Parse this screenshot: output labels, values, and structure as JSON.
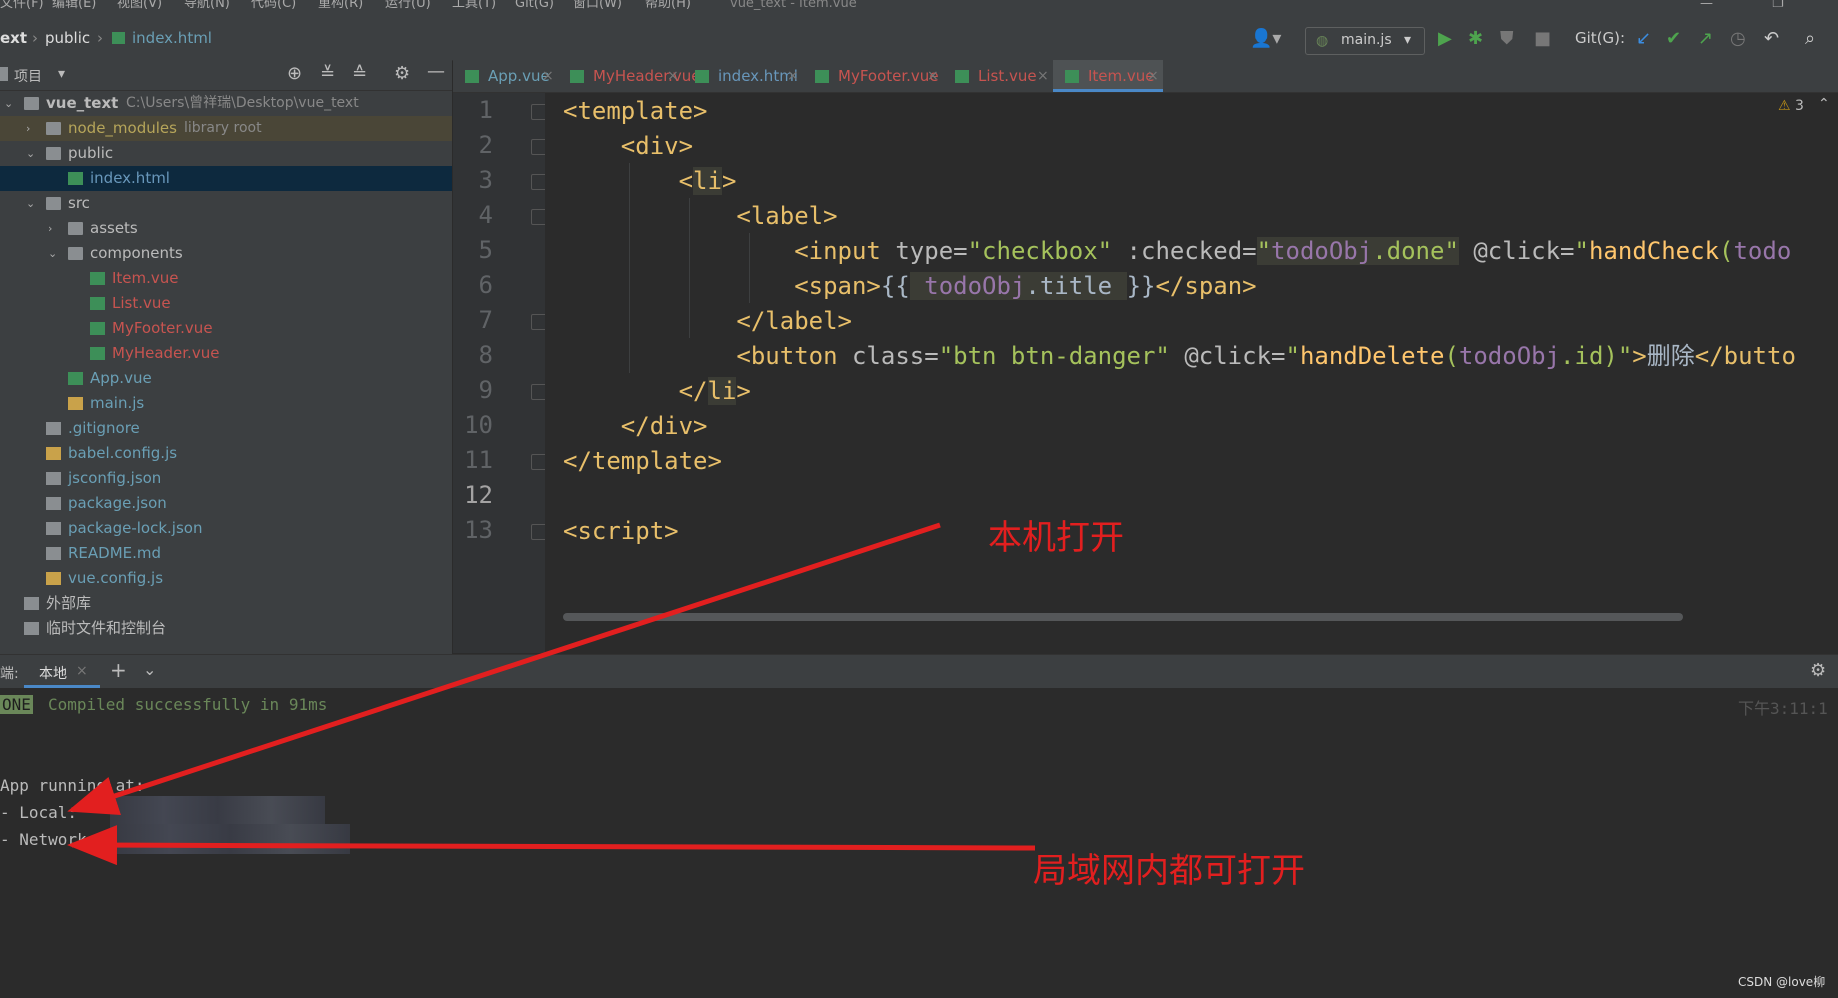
{
  "menu": {
    "items": [
      "文件(F)",
      "编辑(E)",
      "视图(V)",
      "导航(N)",
      "代码(C)",
      "重构(R)",
      "运行(U)",
      "工具(T)",
      "Git(G)",
      "窗口(W)",
      "帮助(H)"
    ],
    "window_title": "vue_text - Item.vue"
  },
  "breadcrumb": [
    "ext",
    "public",
    "index.html"
  ],
  "toolbar": {
    "run_config": "main.js",
    "git_label": "Git(G):"
  },
  "project_panel": {
    "title": "项目"
  },
  "tree": [
    {
      "label": "vue_text",
      "extra": "C:\\Users\\曾祥瑞\\Desktop\\vue_text",
      "type": "folder",
      "depth": 0,
      "expanded": true,
      "color": "#bbbbbb"
    },
    {
      "label": "node_modules",
      "extra": "library root",
      "type": "folder",
      "depth": 1,
      "expanded": false,
      "color": "#b6a55a"
    },
    {
      "label": "public",
      "extra": "",
      "type": "folder",
      "depth": 1,
      "expanded": true,
      "color": "#bbbbbb"
    },
    {
      "label": "index.html",
      "extra": "",
      "type": "file",
      "depth": 2,
      "color": "#6897bb",
      "selected": true
    },
    {
      "label": "src",
      "extra": "",
      "type": "folder",
      "depth": 1,
      "expanded": true,
      "color": "#bbbbbb"
    },
    {
      "label": "assets",
      "extra": "",
      "type": "folder",
      "depth": 2,
      "expanded": false,
      "color": "#bbbbbb"
    },
    {
      "label": "components",
      "extra": "",
      "type": "folder",
      "depth": 2,
      "expanded": true,
      "color": "#bbbbbb"
    },
    {
      "label": "Item.vue",
      "extra": "",
      "type": "vue",
      "depth": 3,
      "color": "#c75450"
    },
    {
      "label": "List.vue",
      "extra": "",
      "type": "vue",
      "depth": 3,
      "color": "#c75450"
    },
    {
      "label": "MyFooter.vue",
      "extra": "",
      "type": "vue",
      "depth": 3,
      "color": "#c75450"
    },
    {
      "label": "MyHeader.vue",
      "extra": "",
      "type": "vue",
      "depth": 3,
      "color": "#c75450"
    },
    {
      "label": "App.vue",
      "extra": "",
      "type": "vue",
      "depth": 2,
      "color": "#6a9fb5"
    },
    {
      "label": "main.js",
      "extra": "",
      "type": "js",
      "depth": 2,
      "color": "#6a9fb5"
    },
    {
      "label": ".gitignore",
      "extra": "",
      "type": "gen",
      "depth": 1,
      "color": "#6a9fb5"
    },
    {
      "label": "babel.config.js",
      "extra": "",
      "type": "js",
      "depth": 1,
      "color": "#6a9fb5"
    },
    {
      "label": "jsconfig.json",
      "extra": "",
      "type": "gen",
      "depth": 1,
      "color": "#6a9fb5"
    },
    {
      "label": "package.json",
      "extra": "",
      "type": "gen",
      "depth": 1,
      "color": "#6a9fb5"
    },
    {
      "label": "package-lock.json",
      "extra": "",
      "type": "gen",
      "depth": 1,
      "color": "#6a9fb5"
    },
    {
      "label": "README.md",
      "extra": "",
      "type": "gen",
      "depth": 1,
      "color": "#6a9fb5"
    },
    {
      "label": "vue.config.js",
      "extra": "",
      "type": "js",
      "depth": 1,
      "color": "#6a9fb5"
    },
    {
      "label": "外部库",
      "extra": "",
      "type": "lib",
      "depth": 0,
      "color": "#bbbbbb"
    },
    {
      "label": "临时文件和控制台",
      "extra": "",
      "type": "scratch",
      "depth": 0,
      "color": "#bbbbbb"
    }
  ],
  "tabs": [
    {
      "label": "App.vue",
      "color": "#6a9fb5",
      "active": false
    },
    {
      "label": "MyHeader.vue",
      "color": "#c75450",
      "active": false
    },
    {
      "label": "index.html",
      "color": "#6897bb",
      "active": false
    },
    {
      "label": "MyFooter.vue",
      "color": "#c75450",
      "active": false
    },
    {
      "label": "List.vue",
      "color": "#c75450",
      "active": false
    },
    {
      "label": "Item.vue",
      "color": "#c75450",
      "active": true
    }
  ],
  "editor": {
    "warnings": "3",
    "line_numbers": [
      "1",
      "2",
      "3",
      "4",
      "5",
      "6",
      "7",
      "8",
      "9",
      "10",
      "11",
      "12",
      "13"
    ],
    "current_line": "12"
  },
  "terminal": {
    "label": "端:",
    "tab": "本地",
    "done_badge": "ONE",
    "compiled": "Compiled successfully in 91ms",
    "time": "下午3:11:1",
    "app_running": "App running at:",
    "local": "- Local:",
    "network": "- Network:"
  },
  "annotations": {
    "local": "本机打开",
    "network": "局域网内都可打开"
  },
  "watermark": "CSDN @love柳"
}
